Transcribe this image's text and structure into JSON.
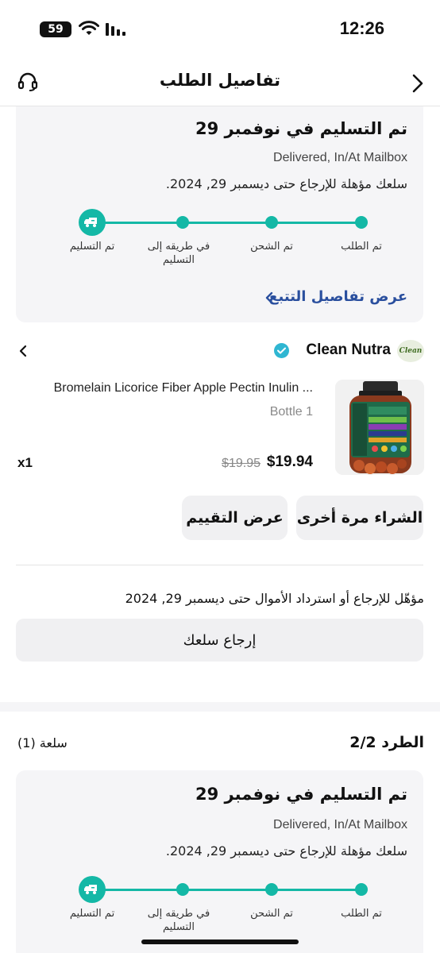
{
  "status_bar": {
    "battery": "59",
    "time": "12:26"
  },
  "header": {
    "title": "تفاصيل الطلب"
  },
  "delivery": {
    "title": "تم التسليم في نوفمبر 29",
    "status": "Delivered, In/At Mailbox",
    "return_eligibility": "سلعك مؤهلة للإرجاع حتى ديسمبر 29, 2024.",
    "steps": [
      "تم الطلب",
      "تم الشحن",
      "في طريقه إلى التسليم",
      "تم التسليم"
    ],
    "tracking_link": "عرض تفاصيل التتبع"
  },
  "store": {
    "name": "Clean Nutra",
    "logo_text": "Clean"
  },
  "product": {
    "name": "Bromelain Licorice Fiber Apple Pectin Inulin ...",
    "variant": "Bottle 1",
    "price": "$19.94",
    "original_price": "$19.95",
    "quantity": "x1"
  },
  "actions": {
    "buy_again": "الشراء مرة أخرى",
    "view_review": "عرض التقييم"
  },
  "returns": {
    "note": "مؤهّل للإرجاع أو استرداد الأموال حتى ديسمبر 29, 2024",
    "return_button": "إرجاع سلعك"
  },
  "parcel": {
    "title": "الطرد 2/2",
    "count": "سلعة (1)"
  },
  "delivery_2": {
    "title": "تم التسليم في نوفمبر 29",
    "status": "Delivered, In/At Mailbox",
    "return_eligibility": "سلعك مؤهلة للإرجاع حتى ديسمبر 29, 2024.",
    "steps": [
      "تم الطلب",
      "تم الشحن",
      "في طريقه إلى التسليم",
      "تم التسليم"
    ]
  },
  "colors": {
    "accent": "#14b8a6",
    "link": "#2a4f9e",
    "card_bg": "#f5f5f7",
    "verified": "#2fb6d2"
  },
  "icons": [
    "battery-icon",
    "wifi-icon",
    "signal-icon",
    "headset-icon",
    "chevron-right-icon",
    "truck-icon",
    "chevron-left-icon",
    "verified-check-icon"
  ]
}
